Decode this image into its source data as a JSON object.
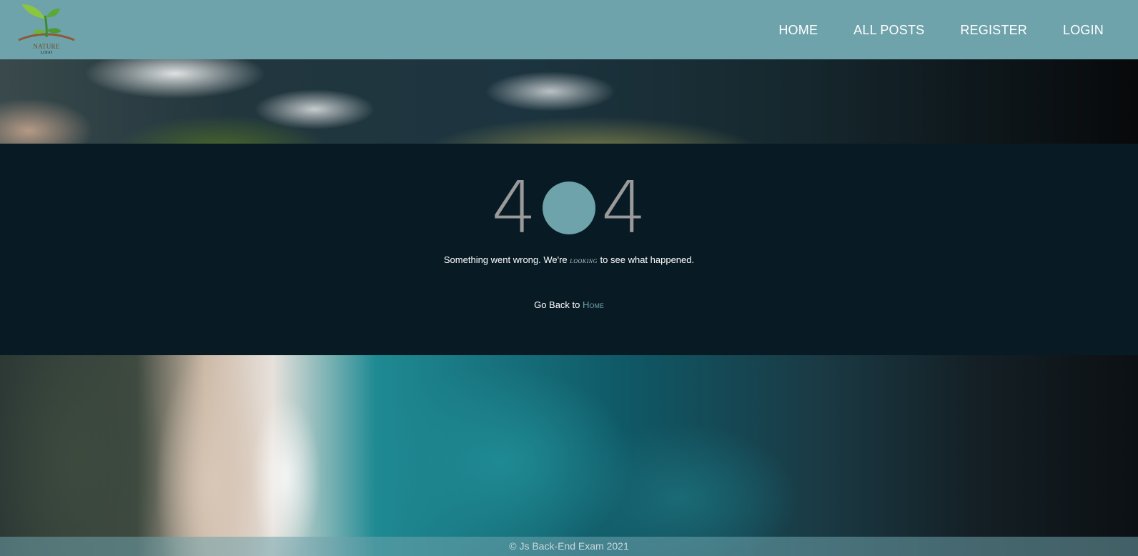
{
  "header": {
    "logo": {
      "title": "NATURE",
      "subtitle": "LOGO"
    },
    "nav": [
      {
        "label": "HOME"
      },
      {
        "label": "ALL POSTS"
      },
      {
        "label": "REGISTER"
      },
      {
        "label": "LOGIN"
      }
    ]
  },
  "error": {
    "code_left": "4",
    "code_right": "4",
    "message_before": "Something went wrong. We're",
    "message_emphasis": "looking",
    "message_after": "to see what happened.",
    "goback_text": "Go Back to",
    "home_link": "Home"
  },
  "footer": {
    "text": "© Js Back-End Exam 2021"
  },
  "colors": {
    "accent": "#6fa3ab",
    "panel": "#081b24",
    "digit": "#9a9a9a"
  }
}
